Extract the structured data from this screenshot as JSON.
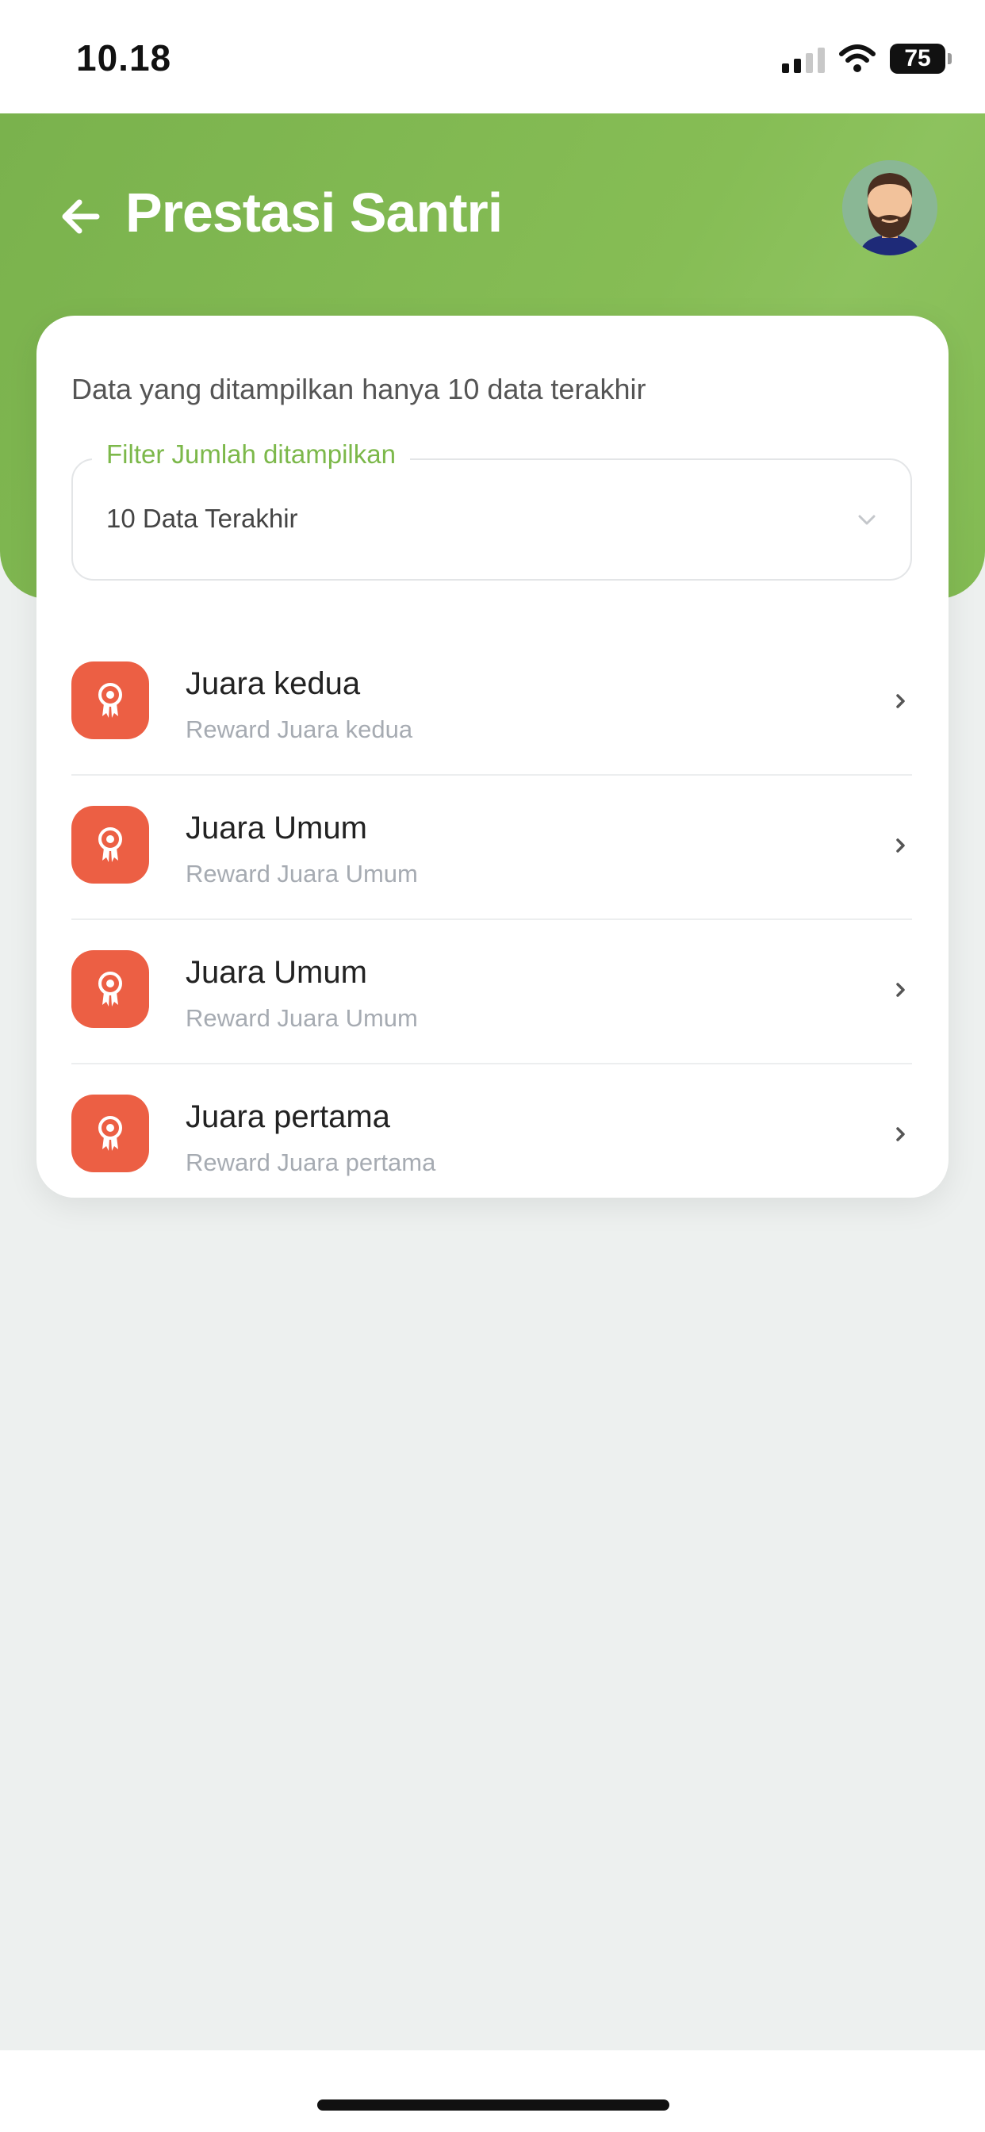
{
  "status_bar": {
    "time": "10.18",
    "battery": "75"
  },
  "header": {
    "title": "Prestasi Santri"
  },
  "card": {
    "info_text": "Data yang ditampilkan hanya 10 data terakhir",
    "filter": {
      "label": "Filter Jumlah ditampilkan",
      "value": "10 Data Terakhir"
    },
    "items": [
      {
        "title": "Juara kedua",
        "subtitle": "Reward Juara kedua"
      },
      {
        "title": "Juara Umum",
        "subtitle": "Reward Juara Umum"
      },
      {
        "title": "Juara Umum",
        "subtitle": "Reward Juara Umum"
      },
      {
        "title": "Juara pertama",
        "subtitle": "Reward Juara pertama"
      }
    ]
  },
  "colors": {
    "header_green": "#86bd55",
    "accent_green": "#7cb84a",
    "badge_red": "#ec5f44"
  },
  "icons": {
    "back": "arrow-left-icon",
    "avatar": "bearded-man-avatar",
    "item_badge": "award-ribbon-icon",
    "item_chevron": "chevron-right-icon",
    "filter_chevron": "chevron-down-icon"
  }
}
